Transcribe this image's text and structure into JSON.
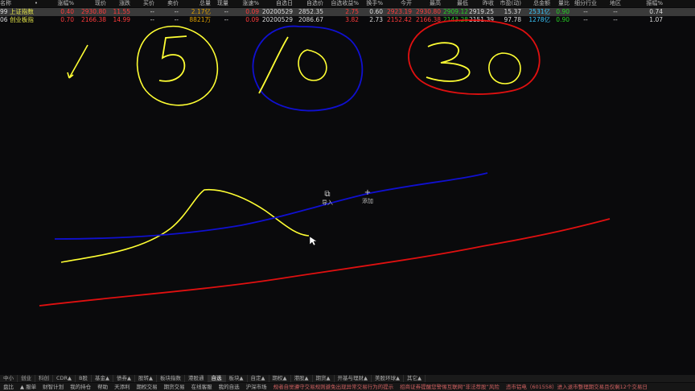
{
  "headers": [
    "名称",
    "•",
    "涨幅%",
    "现价",
    "涨跌",
    "买价",
    "卖价",
    "总量",
    "现量",
    "涨速%",
    "自选日",
    "自选价",
    "自选收益%",
    "换手%",
    "今开",
    "最高",
    "最低",
    "昨收",
    "市盈(动)",
    "总金额",
    "量比",
    "细分行业",
    "地区",
    "振幅%"
  ],
  "rows": [
    {
      "code": "99",
      "name": "上证指数",
      "chg_pct": "0.40",
      "price": "2930.80",
      "chg": "11.55",
      "bid": "--",
      "ask": "--",
      "vol": "2.17亿",
      "cur_vol": "--",
      "speed": "0.09",
      "sel_date": "20200529",
      "sel_price": "2852.35",
      "sel_ret": "2.75",
      "turnover": "0.60",
      "open": "2923.19",
      "high": "2930.80",
      "low": "2909.12",
      "prev": "2919.25",
      "pe": "15.37",
      "amount": "2531亿",
      "vol_ratio": "0.90",
      "industry": "--",
      "region": "--",
      "amp": "0.74"
    },
    {
      "code": "06",
      "name": "创业板指",
      "chg_pct": "0.70",
      "price": "2166.38",
      "chg": "14.99",
      "bid": "--",
      "ask": "--",
      "vol": "8821万",
      "cur_vol": "--",
      "speed": "0.09",
      "sel_date": "20200529",
      "sel_price": "2086.67",
      "sel_ret": "3.82",
      "turnover": "2.73",
      "open": "2152.42",
      "high": "2166.38",
      "low": "2143.28",
      "prev": "2151.39",
      "pe": "97.78",
      "amount": "1278亿",
      "vol_ratio": "0.90",
      "industry": "--",
      "region": "--",
      "amp": "1.07"
    }
  ],
  "float_tools": {
    "import_label": "导入",
    "add_label": "添加"
  },
  "tabs": [
    "中小",
    "创业",
    "科创",
    "CDR▲",
    "B股",
    "基金▲",
    "债券▲",
    "股转▲",
    "板块指数",
    "港股通",
    "自选",
    "板块▲",
    "自定▲",
    "期权▲",
    "港股▲",
    "期货▲",
    "开基与理财▲",
    "美股环球▲",
    "其它▲"
  ],
  "active_tab": "自选",
  "status": {
    "left_items": [
      "盘比",
      "▲ 服单",
      "财智计划",
      "我的持仓",
      "帮助",
      "天添利",
      "期权交易",
      "期货交易",
      "在线客服",
      "我的自选",
      "沪深市场"
    ],
    "news1": "规者自觉遵守交易规则避免出现异常交易行为的提示",
    "news2": "招商证券提醒您警惕互联网“非法荐股”风险",
    "news3": "违市铝电（601558）进入退市整理期交易且仅剩12个交易日"
  },
  "colors": {
    "up": "#ff3b3b",
    "down": "#25d125",
    "yellow_line": "#ffff33",
    "blue_line": "#1010d0",
    "red_line": "#e01010"
  }
}
